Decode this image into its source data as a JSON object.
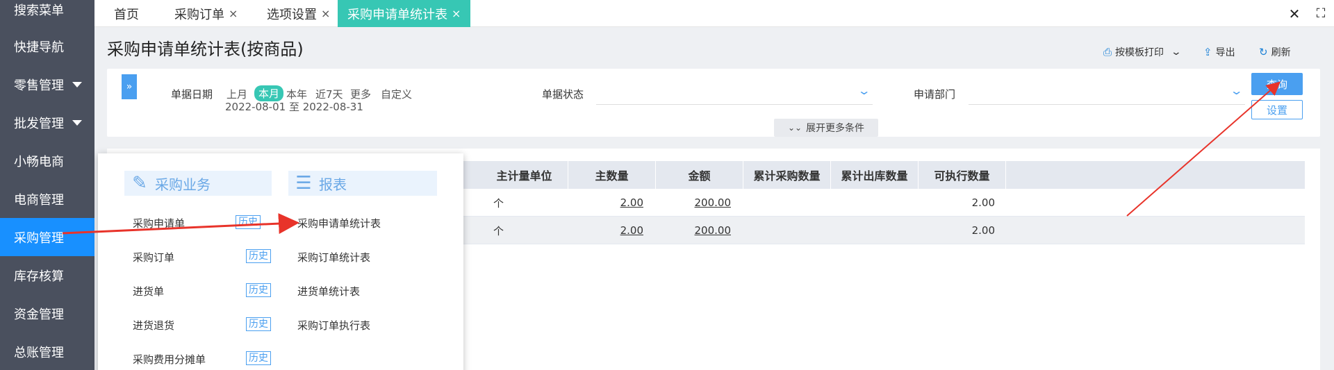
{
  "sidebar": {
    "items": [
      {
        "label": "搜索菜单"
      },
      {
        "label": "快捷导航"
      },
      {
        "label": "零售管理"
      },
      {
        "label": "批发管理"
      },
      {
        "label": "小畅电商"
      },
      {
        "label": "电商管理"
      },
      {
        "label": "采购管理"
      },
      {
        "label": "库存核算"
      },
      {
        "label": "资金管理"
      },
      {
        "label": "总账管理"
      }
    ],
    "active_color": "#1890ff"
  },
  "tabs": [
    {
      "label": "首页"
    },
    {
      "label": "采购订单",
      "close": "×"
    },
    {
      "label": "选项设置",
      "close": "×"
    },
    {
      "label": "采购申请单统计表",
      "close": "×"
    }
  ],
  "window": {
    "close": "✕",
    "fullscreen": "⛶"
  },
  "page": {
    "title": "采购申请单统计表(按商品)",
    "actions": {
      "print": "按模板打印",
      "export": "导出",
      "refresh": "刷新"
    }
  },
  "filters": {
    "date_label": "单据日期",
    "date_chips": [
      "上月",
      "本月",
      "本年",
      "近7天",
      "更多",
      "自定义"
    ],
    "date_range": "2022-08-01 至 2022-08-31",
    "status_label": "单据状态",
    "dept_label": "申请部门",
    "query": "查询",
    "settings": "设置",
    "more_conditions": "展开更多条件"
  },
  "table": {
    "headers": [
      "主计量单位",
      "主数量",
      "金额",
      "累计采购数量",
      "累计出库数量",
      "可执行数量"
    ],
    "rows": [
      {
        "unit": "个",
        "qty": "2.00",
        "amount": "200.00",
        "exec": "2.00"
      },
      {
        "unit": "个",
        "qty": "2.00",
        "amount": "200.00",
        "exec": "2.00"
      }
    ]
  },
  "popup": {
    "purchase_section": "采购业务",
    "report_section": "报表",
    "purchase_items": [
      "采购申请单",
      "采购订单",
      "进货单",
      "进货退货",
      "采购费用分摊单"
    ],
    "history_label": "历史",
    "report_items": [
      "采购申请单统计表",
      "采购订单统计表",
      "进货单统计表",
      "采购订单执行表"
    ]
  },
  "colors": {
    "accent": "#37c7b4",
    "primary": "#4a9ff0",
    "sidebar": "#4a505e",
    "arrow": "#e8332a"
  }
}
